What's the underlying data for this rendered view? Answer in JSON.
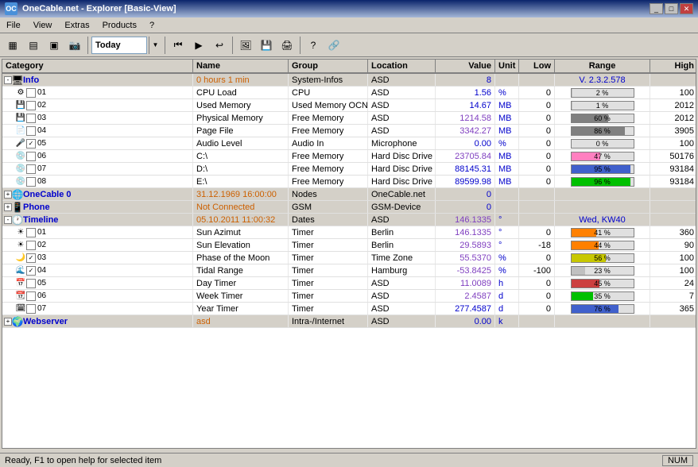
{
  "titlebar": {
    "title": "OneCable.net - Explorer [Basic-View]",
    "icon": "OC",
    "buttons": [
      "_",
      "□",
      "✕"
    ]
  },
  "menu": {
    "items": [
      "File",
      "View",
      "Extras",
      "Products",
      "?"
    ]
  },
  "toolbar": {
    "today_label": "Today",
    "buttons": [
      "grid1",
      "grid2",
      "grid3",
      "cam",
      "nav",
      "forward",
      "back",
      "refresh",
      "img",
      "floppy",
      "printer",
      "help",
      "link"
    ]
  },
  "table": {
    "headers": [
      "Category",
      "Name",
      "Group",
      "Location",
      "Value",
      "Unit",
      "Low",
      "Range",
      "High"
    ],
    "rows": [
      {
        "indent": 0,
        "type": "section",
        "expand": true,
        "icon": "pc",
        "num": "",
        "checked": null,
        "category": "Info",
        "name": "0 hours 1 min",
        "group": "System-Infos",
        "location": "ASD",
        "value": "8",
        "unit": "",
        "low": "",
        "range_pct": 0,
        "range_text": "V. 2.3.2.578",
        "high": "",
        "name_color": "orange",
        "value_color": "blue",
        "range_color": "blue"
      },
      {
        "indent": 1,
        "type": "data",
        "expand": false,
        "icon": "cpu",
        "num": "01",
        "checked": false,
        "category": "",
        "name": "CPU Load",
        "group": "CPU",
        "location": "ASD",
        "value": "1.56",
        "unit": "%",
        "low": "0",
        "range_pct": 2,
        "range_text": "2 %",
        "high": "100",
        "name_color": "black",
        "value_color": "blue"
      },
      {
        "indent": 1,
        "type": "data",
        "expand": false,
        "icon": "mem",
        "num": "02",
        "checked": false,
        "category": "",
        "name": "Used Memory",
        "group": "Used Memory OCN",
        "location": "ASD",
        "value": "14.67",
        "unit": "MB",
        "low": "0",
        "range_pct": 1,
        "range_text": "1 %",
        "high": "2012",
        "name_color": "black",
        "value_color": "blue"
      },
      {
        "indent": 1,
        "type": "data",
        "expand": false,
        "icon": "mem",
        "num": "03",
        "checked": false,
        "category": "",
        "name": "Physical Memory",
        "group": "Free Memory",
        "location": "ASD",
        "value": "1214.58",
        "unit": "MB",
        "low": "0",
        "range_pct": 60,
        "range_text": "60 %",
        "high": "2012",
        "name_color": "black",
        "value_color": "purple",
        "bar_color": "gray"
      },
      {
        "indent": 1,
        "type": "data",
        "expand": false,
        "icon": "file",
        "num": "04",
        "checked": false,
        "category": "",
        "name": "Page File",
        "group": "Free Memory",
        "location": "ASD",
        "value": "3342.27",
        "unit": "MB",
        "low": "0",
        "range_pct": 86,
        "range_text": "86 %",
        "high": "3905",
        "name_color": "black",
        "value_color": "purple",
        "bar_color": "gray"
      },
      {
        "indent": 1,
        "type": "data",
        "expand": false,
        "icon": "audio",
        "num": "05",
        "checked": true,
        "category": "",
        "name": "Audio Level",
        "group": "Audio In",
        "location": "Microphone",
        "value": "0.00",
        "unit": "%",
        "low": "0",
        "range_pct": 0,
        "range_text": "0 %",
        "high": "100",
        "name_color": "black",
        "value_color": "blue"
      },
      {
        "indent": 1,
        "type": "data",
        "expand": false,
        "icon": "hdd",
        "num": "06",
        "checked": false,
        "category": "",
        "name": "C:\\",
        "group": "Free Memory",
        "location": "Hard Disc Drive",
        "value": "23705.84",
        "unit": "MB",
        "low": "0",
        "range_pct": 47,
        "range_text": "47 %",
        "high": "50176",
        "name_color": "black",
        "value_color": "purple",
        "bar_color": "pink"
      },
      {
        "indent": 1,
        "type": "data",
        "expand": false,
        "icon": "hdd",
        "num": "07",
        "checked": false,
        "category": "",
        "name": "D:\\",
        "group": "Free Memory",
        "location": "Hard Disc Drive",
        "value": "88145.31",
        "unit": "MB",
        "low": "0",
        "range_pct": 95,
        "range_text": "95 %",
        "high": "93184",
        "name_color": "black",
        "value_color": "blue",
        "bar_color": "blue"
      },
      {
        "indent": 1,
        "type": "data",
        "expand": false,
        "icon": "hdd",
        "num": "08",
        "checked": false,
        "category": "",
        "name": "E:\\",
        "group": "Free Memory",
        "location": "Hard Disc Drive",
        "value": "89599.98",
        "unit": "MB",
        "low": "0",
        "range_pct": 96,
        "range_text": "96 %",
        "high": "93184",
        "name_color": "black",
        "value_color": "blue",
        "bar_color": "green"
      },
      {
        "indent": 0,
        "type": "section",
        "expand": false,
        "icon": "net",
        "num": "",
        "checked": null,
        "category": "OneCable 0",
        "name": "31.12.1969 16:00:00",
        "group": "Nodes",
        "location": "OneCable.net",
        "value": "0",
        "unit": "",
        "low": "",
        "range_pct": 0,
        "range_text": "",
        "high": "",
        "name_color": "orange",
        "value_color": "blue"
      },
      {
        "indent": 0,
        "type": "section",
        "expand": false,
        "icon": "phone",
        "num": "",
        "checked": null,
        "category": "Phone",
        "name": "Not Connected",
        "group": "GSM",
        "location": "GSM-Device",
        "value": "0",
        "unit": "",
        "low": "",
        "range_pct": 0,
        "range_text": "",
        "high": "",
        "name_color": "orange",
        "value_color": "blue"
      },
      {
        "indent": 0,
        "type": "section",
        "expand": true,
        "icon": "clock",
        "num": "",
        "checked": null,
        "category": "Timeline",
        "name": "05.10.2011 11:00:32",
        "group": "Dates",
        "location": "ASD",
        "value": "146.1335",
        "unit": "°",
        "low": "",
        "range_pct": 0,
        "range_text": "Wed, KW40",
        "high": "",
        "name_color": "orange",
        "value_color": "purple",
        "range_color": "blue"
      },
      {
        "indent": 1,
        "type": "data",
        "expand": false,
        "icon": "sun",
        "num": "01",
        "checked": false,
        "category": "",
        "name": "Sun Azimut",
        "group": "Timer",
        "location": "Berlin",
        "value": "146.1335",
        "unit": "°",
        "low": "0",
        "range_pct": 41,
        "range_text": "41 %",
        "high": "360",
        "name_color": "black",
        "value_color": "purple",
        "bar_color": "orange"
      },
      {
        "indent": 1,
        "type": "data",
        "expand": false,
        "icon": "sun",
        "num": "02",
        "checked": false,
        "category": "",
        "name": "Sun Elevation",
        "group": "Timer",
        "location": "Berlin",
        "value": "29.5893",
        "unit": "°",
        "low": "-18",
        "range_pct": 44,
        "range_text": "44 %",
        "high": "90",
        "name_color": "black",
        "value_color": "purple",
        "bar_color": "orange"
      },
      {
        "indent": 1,
        "type": "data",
        "expand": false,
        "icon": "moon",
        "num": "03",
        "checked": true,
        "category": "",
        "name": "Phase of the Moon",
        "group": "Timer",
        "location": "Time Zone",
        "value": "55.5370",
        "unit": "%",
        "low": "0",
        "range_pct": 56,
        "range_text": "56 %",
        "high": "100",
        "name_color": "black",
        "value_color": "purple",
        "bar_color": "yellow"
      },
      {
        "indent": 1,
        "type": "data",
        "expand": false,
        "icon": "wave",
        "num": "04",
        "checked": true,
        "category": "",
        "name": "Tidal Range",
        "group": "Timer",
        "location": "Hamburg",
        "value": "-53.8425",
        "unit": "%",
        "low": "-100",
        "range_pct": 23,
        "range_text": "23 %",
        "high": "100",
        "name_color": "black",
        "value_color": "purple"
      },
      {
        "indent": 1,
        "type": "data",
        "expand": false,
        "icon": "day",
        "num": "05",
        "checked": false,
        "category": "",
        "name": "Day Timer",
        "group": "Timer",
        "location": "ASD",
        "value": "11.0089",
        "unit": "h",
        "low": "0",
        "range_pct": 45,
        "range_text": "45 %",
        "high": "24",
        "name_color": "black",
        "value_color": "purple",
        "bar_color": "red"
      },
      {
        "indent": 1,
        "type": "data",
        "expand": false,
        "icon": "week",
        "num": "06",
        "checked": false,
        "category": "",
        "name": "Week Timer",
        "group": "Timer",
        "location": "ASD",
        "value": "2.4587",
        "unit": "d",
        "low": "0",
        "range_pct": 35,
        "range_text": "35 %",
        "high": "7",
        "name_color": "black",
        "value_color": "purple",
        "bar_color": "green"
      },
      {
        "indent": 1,
        "type": "data",
        "expand": false,
        "icon": "year",
        "num": "07",
        "checked": false,
        "category": "",
        "name": "Year Timer",
        "group": "Timer",
        "location": "ASD",
        "value": "277.4587",
        "unit": "d",
        "low": "0",
        "range_pct": 76,
        "range_text": "76 %",
        "high": "365",
        "name_color": "black",
        "value_color": "blue",
        "bar_color": "blue"
      },
      {
        "indent": 0,
        "type": "section",
        "expand": false,
        "icon": "web",
        "num": "",
        "checked": null,
        "category": "Webserver",
        "name": "asd",
        "group": "Intra-/Internet",
        "location": "ASD",
        "value": "0.00",
        "unit": "k",
        "low": "",
        "range_pct": 0,
        "range_text": "",
        "high": "",
        "name_color": "orange",
        "value_color": "blue"
      }
    ]
  },
  "statusbar": {
    "left": "Ready, F1 to open help for selected item",
    "right": "NUM"
  }
}
